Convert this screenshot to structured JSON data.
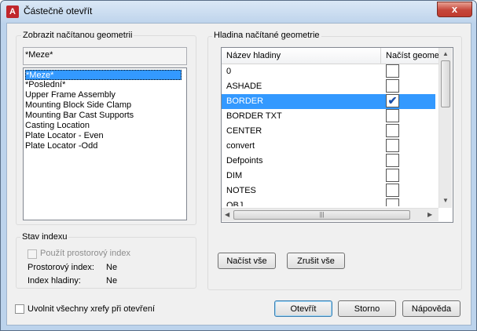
{
  "window": {
    "title": "Částečně otevřít",
    "close_glyph": "x"
  },
  "left_group": {
    "label": "Zobrazit načítanou geometrii",
    "selected_value": "*Meze*",
    "items": [
      {
        "label": "*Meze*",
        "selected": true
      },
      {
        "label": "*Poslední*",
        "selected": false
      },
      {
        "label": "Upper Frame Assembly",
        "selected": false
      },
      {
        "label": "Mounting Block Side Clamp",
        "selected": false
      },
      {
        "label": "Mounting Bar Cast Supports",
        "selected": false
      },
      {
        "label": "Casting Location",
        "selected": false
      },
      {
        "label": "Plate Locator - Even",
        "selected": false
      },
      {
        "label": "Plate Locator -Odd",
        "selected": false
      }
    ]
  },
  "index_group": {
    "label": "Stav indexu",
    "spatial_checkbox_label": "Použít prostorový index",
    "spatial_index_label": "Prostorový index:",
    "spatial_index_value": "Ne",
    "layer_index_label": "Index hladiny:",
    "layer_index_value": "Ne"
  },
  "right_group": {
    "label": "Hladina načítané geometrie",
    "columns": [
      "Název hladiny",
      "Načíst geome"
    ],
    "rows": [
      {
        "name": "0",
        "checked": false,
        "selected": false
      },
      {
        "name": "ASHADE",
        "checked": false,
        "selected": false
      },
      {
        "name": "BORDER",
        "checked": true,
        "selected": true
      },
      {
        "name": "BORDER TXT",
        "checked": false,
        "selected": false
      },
      {
        "name": "CENTER",
        "checked": false,
        "selected": false
      },
      {
        "name": "convert",
        "checked": false,
        "selected": false
      },
      {
        "name": "Defpoints",
        "checked": false,
        "selected": false
      },
      {
        "name": "DIM",
        "checked": false,
        "selected": false
      },
      {
        "name": "NOTES",
        "checked": false,
        "selected": false
      },
      {
        "name": "OBJ",
        "checked": false,
        "selected": false
      }
    ],
    "load_all_button": "Načíst vše",
    "clear_all_button": "Zrušit vše"
  },
  "footer": {
    "unload_xrefs_label": "Uvolnit všechny xrefy při otevření",
    "open_button": "Otevřít",
    "cancel_button": "Storno",
    "help_button": "Nápověda"
  }
}
